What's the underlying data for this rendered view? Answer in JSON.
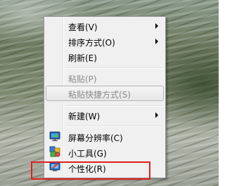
{
  "context_menu": {
    "items": [
      {
        "label": "查看(V)",
        "has_submenu": true,
        "enabled": true
      },
      {
        "label": "排序方式(O)",
        "has_submenu": true,
        "enabled": true
      },
      {
        "label": "刷新(E)",
        "has_submenu": false,
        "enabled": true
      },
      {
        "label": "粘贴(P)",
        "has_submenu": false,
        "enabled": false
      },
      {
        "label": "粘贴快捷方式(S)",
        "has_submenu": false,
        "enabled": false,
        "hovered": true
      },
      {
        "label": "新建(W)",
        "has_submenu": true,
        "enabled": true
      },
      {
        "label": "屏幕分辨率(C)",
        "icon": "monitor-icon",
        "enabled": true
      },
      {
        "label": "小工具(G)",
        "icon": "gadgets-icon",
        "enabled": true
      },
      {
        "label": "个性化(R)",
        "icon": "personalize-icon",
        "enabled": true,
        "highlighted_box": true
      }
    ]
  },
  "colors": {
    "menu_bg": "#f0f0f0",
    "highlight_box": "#e02020",
    "disabled_text": "#8a8a8a"
  }
}
